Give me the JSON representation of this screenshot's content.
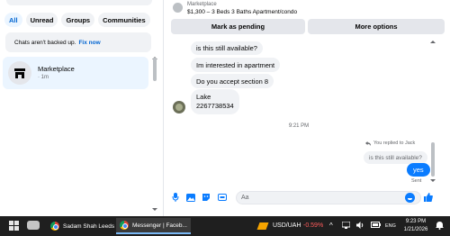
{
  "left": {
    "filters": [
      {
        "label": "All"
      },
      {
        "label": "Unread"
      },
      {
        "label": "Groups"
      },
      {
        "label": "Communities"
      }
    ],
    "backup_text": "Chats aren't backed up.",
    "backup_link": "Fix now",
    "conversation": {
      "title": "Marketplace",
      "time": "· 1m"
    }
  },
  "chat": {
    "listing_source": "Marketplace",
    "listing_title": "$1,300 – 3 Beds 3 Baths Apartment/condo",
    "mark_pending": "Mark as pending",
    "more_options": "More options",
    "incoming": [
      "is this still available?",
      "Im interested in apartment",
      "Do you accept section 8"
    ],
    "last_incoming_line1": "Lake",
    "last_incoming_line2": "2267738534",
    "timestamp": "9:21 PM",
    "reply_label": "You replied to Jack",
    "reply_quote": "is this still available?",
    "outgoing": "yes",
    "sent_status": "Sent",
    "composer_placeholder": "Aa"
  },
  "taskbar": {
    "app1": "Sadam Shah Leeds ...",
    "app2": "Messenger | Faceb...",
    "stock_name": "USD/UAH",
    "stock_change": "-0.59%",
    "lang": "ENG",
    "time": "9:23 PM",
    "date": "1/21/2026"
  },
  "colors": {
    "accent": "#0a7cff",
    "selected_bg": "#ebf5ff",
    "bubble_bg": "#f0f2f5",
    "stock_down": "#ff5c5c"
  }
}
